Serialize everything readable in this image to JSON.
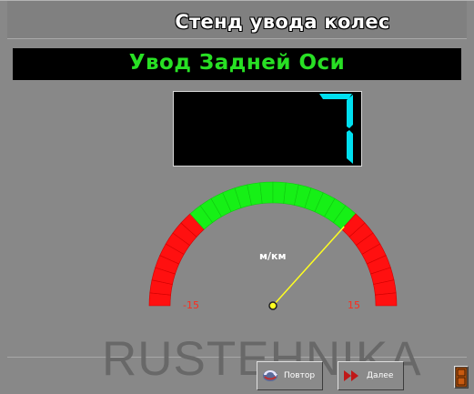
{
  "header": {
    "title": "Стенд увода колес"
  },
  "banner": {
    "title": "Увод Задней Оси"
  },
  "display": {
    "value": "7",
    "digit_color": "#00e0f0"
  },
  "gauge": {
    "unit": "м/км",
    "min_label": "-15",
    "max_label": "15",
    "min": -15,
    "max": 15,
    "value": 7,
    "green_range": [
      -7,
      7
    ],
    "colors": {
      "red": "#ff1010",
      "green": "#16f016",
      "needle": "#ffff20"
    }
  },
  "watermark": {
    "text": "RUSTEHNIKA"
  },
  "buttons": {
    "repeat_label": "Повтор",
    "next_label": "Далее"
  },
  "icons": {
    "repeat": "repeat-icon",
    "next": "next-arrows-icon",
    "exit": "exit-door-icon"
  }
}
